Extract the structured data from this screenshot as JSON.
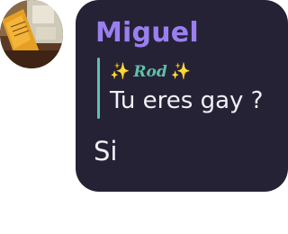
{
  "colors": {
    "bubble_bg": "#262236",
    "sender_name": "#9a7ff0",
    "reply_bar": "#5fc2ad",
    "reply_author": "#5fbfa7",
    "sparkle": "#f3c53a",
    "text": "#f1f0f5"
  },
  "avatar": {
    "icon": "user-avatar-photo"
  },
  "message": {
    "sender": "Miguel",
    "reply": {
      "sparkle_left": "✨",
      "author": "Rod",
      "sparkle_right": "✨",
      "text": "Tu eres gay ?"
    },
    "text": "Si"
  }
}
